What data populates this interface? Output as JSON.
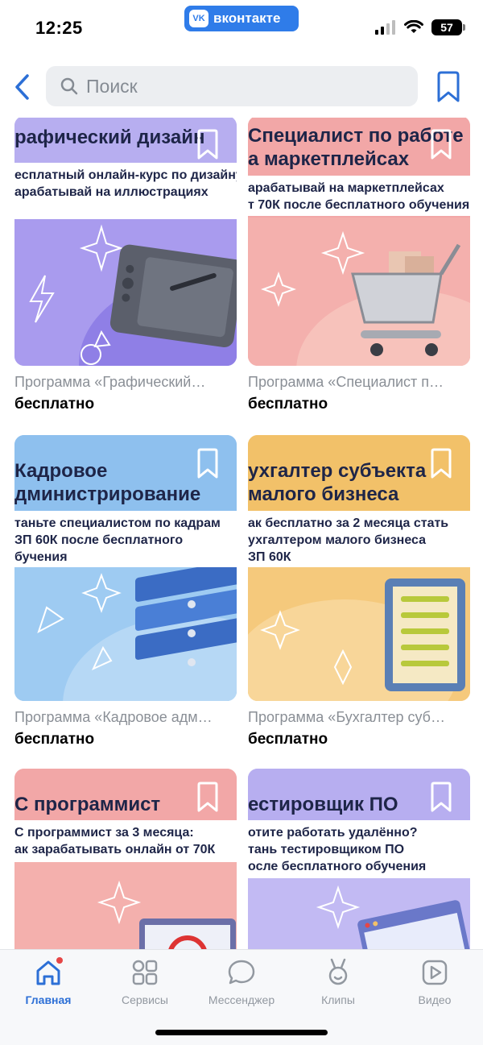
{
  "status": {
    "time": "12:25",
    "carrier_badge": "вконтакте",
    "vk_logo": "VK",
    "battery": "57"
  },
  "header": {
    "search_placeholder": "Поиск",
    "back_icon": "chevron-left-icon",
    "bookmark_icon": "bookmark-icon"
  },
  "cards": [
    {
      "title": "рафический дизайн",
      "subtitle_lines": [
        "есплатный онлайн-курс по дизайну",
        "арабатывай на иллюстрациях"
      ],
      "caption": "Программа «Графический…",
      "price": "бесплатно",
      "bg": "#b7aef0",
      "art": "graphics-tablet"
    },
    {
      "title_lines": [
        "Специалист по работе",
        "а маркетплейсах"
      ],
      "subtitle_lines": [
        "арабатывай на маркетплейсах",
        "т 70К после бесплатного обучения"
      ],
      "caption": "Программа «Специалист п…",
      "price": "бесплатно",
      "bg": "#f2a7a7",
      "art": "shopping-cart"
    },
    {
      "title_lines": [
        "Кадровое",
        "дминистрирование"
      ],
      "subtitle_lines": [
        "таньте специалистом по кадрам",
        "ЗП 60К после бесплатного",
        "бучения"
      ],
      "caption": "Программа «Кадровое адм…",
      "price": "бесплатно",
      "bg": "#8ec0ee",
      "art": "binders"
    },
    {
      "title_lines": [
        "ухгалтер субъекта",
        "малого бизнеса"
      ],
      "subtitle_lines": [
        "ак бесплатно за 2 месяца стать",
        "ухгалтером малого бизнеса",
        "ЗП 60К"
      ],
      "caption": "Программа «Бухгалтер суб…",
      "price": "бесплатно",
      "bg": "#f2c169",
      "art": "abacus"
    },
    {
      "title": "С программист",
      "subtitle_lines": [
        "С программист за 3 месяца:",
        "ак зарабатывать онлайн от 70К"
      ],
      "bg": "#f2a7a7",
      "art": "1c-logo"
    },
    {
      "title": "естировщик ПО",
      "subtitle_lines": [
        "отите работать удалённо?",
        "тань тестировщиком ПО",
        "осле бесплатного обучения"
      ],
      "bg": "#b7aef0",
      "art": "browser-window"
    }
  ],
  "tabs": [
    {
      "label": "Главная",
      "icon": "home-icon",
      "active": true
    },
    {
      "label": "Сервисы",
      "icon": "grid-icon"
    },
    {
      "label": "Мессенджер",
      "icon": "chat-icon"
    },
    {
      "label": "Клипы",
      "icon": "clips-icon"
    },
    {
      "label": "Видео",
      "icon": "video-icon"
    }
  ],
  "colors": {
    "accent": "#2c6fd6",
    "vk_blue": "#2f7ce9",
    "title_text": "#1e2548"
  }
}
